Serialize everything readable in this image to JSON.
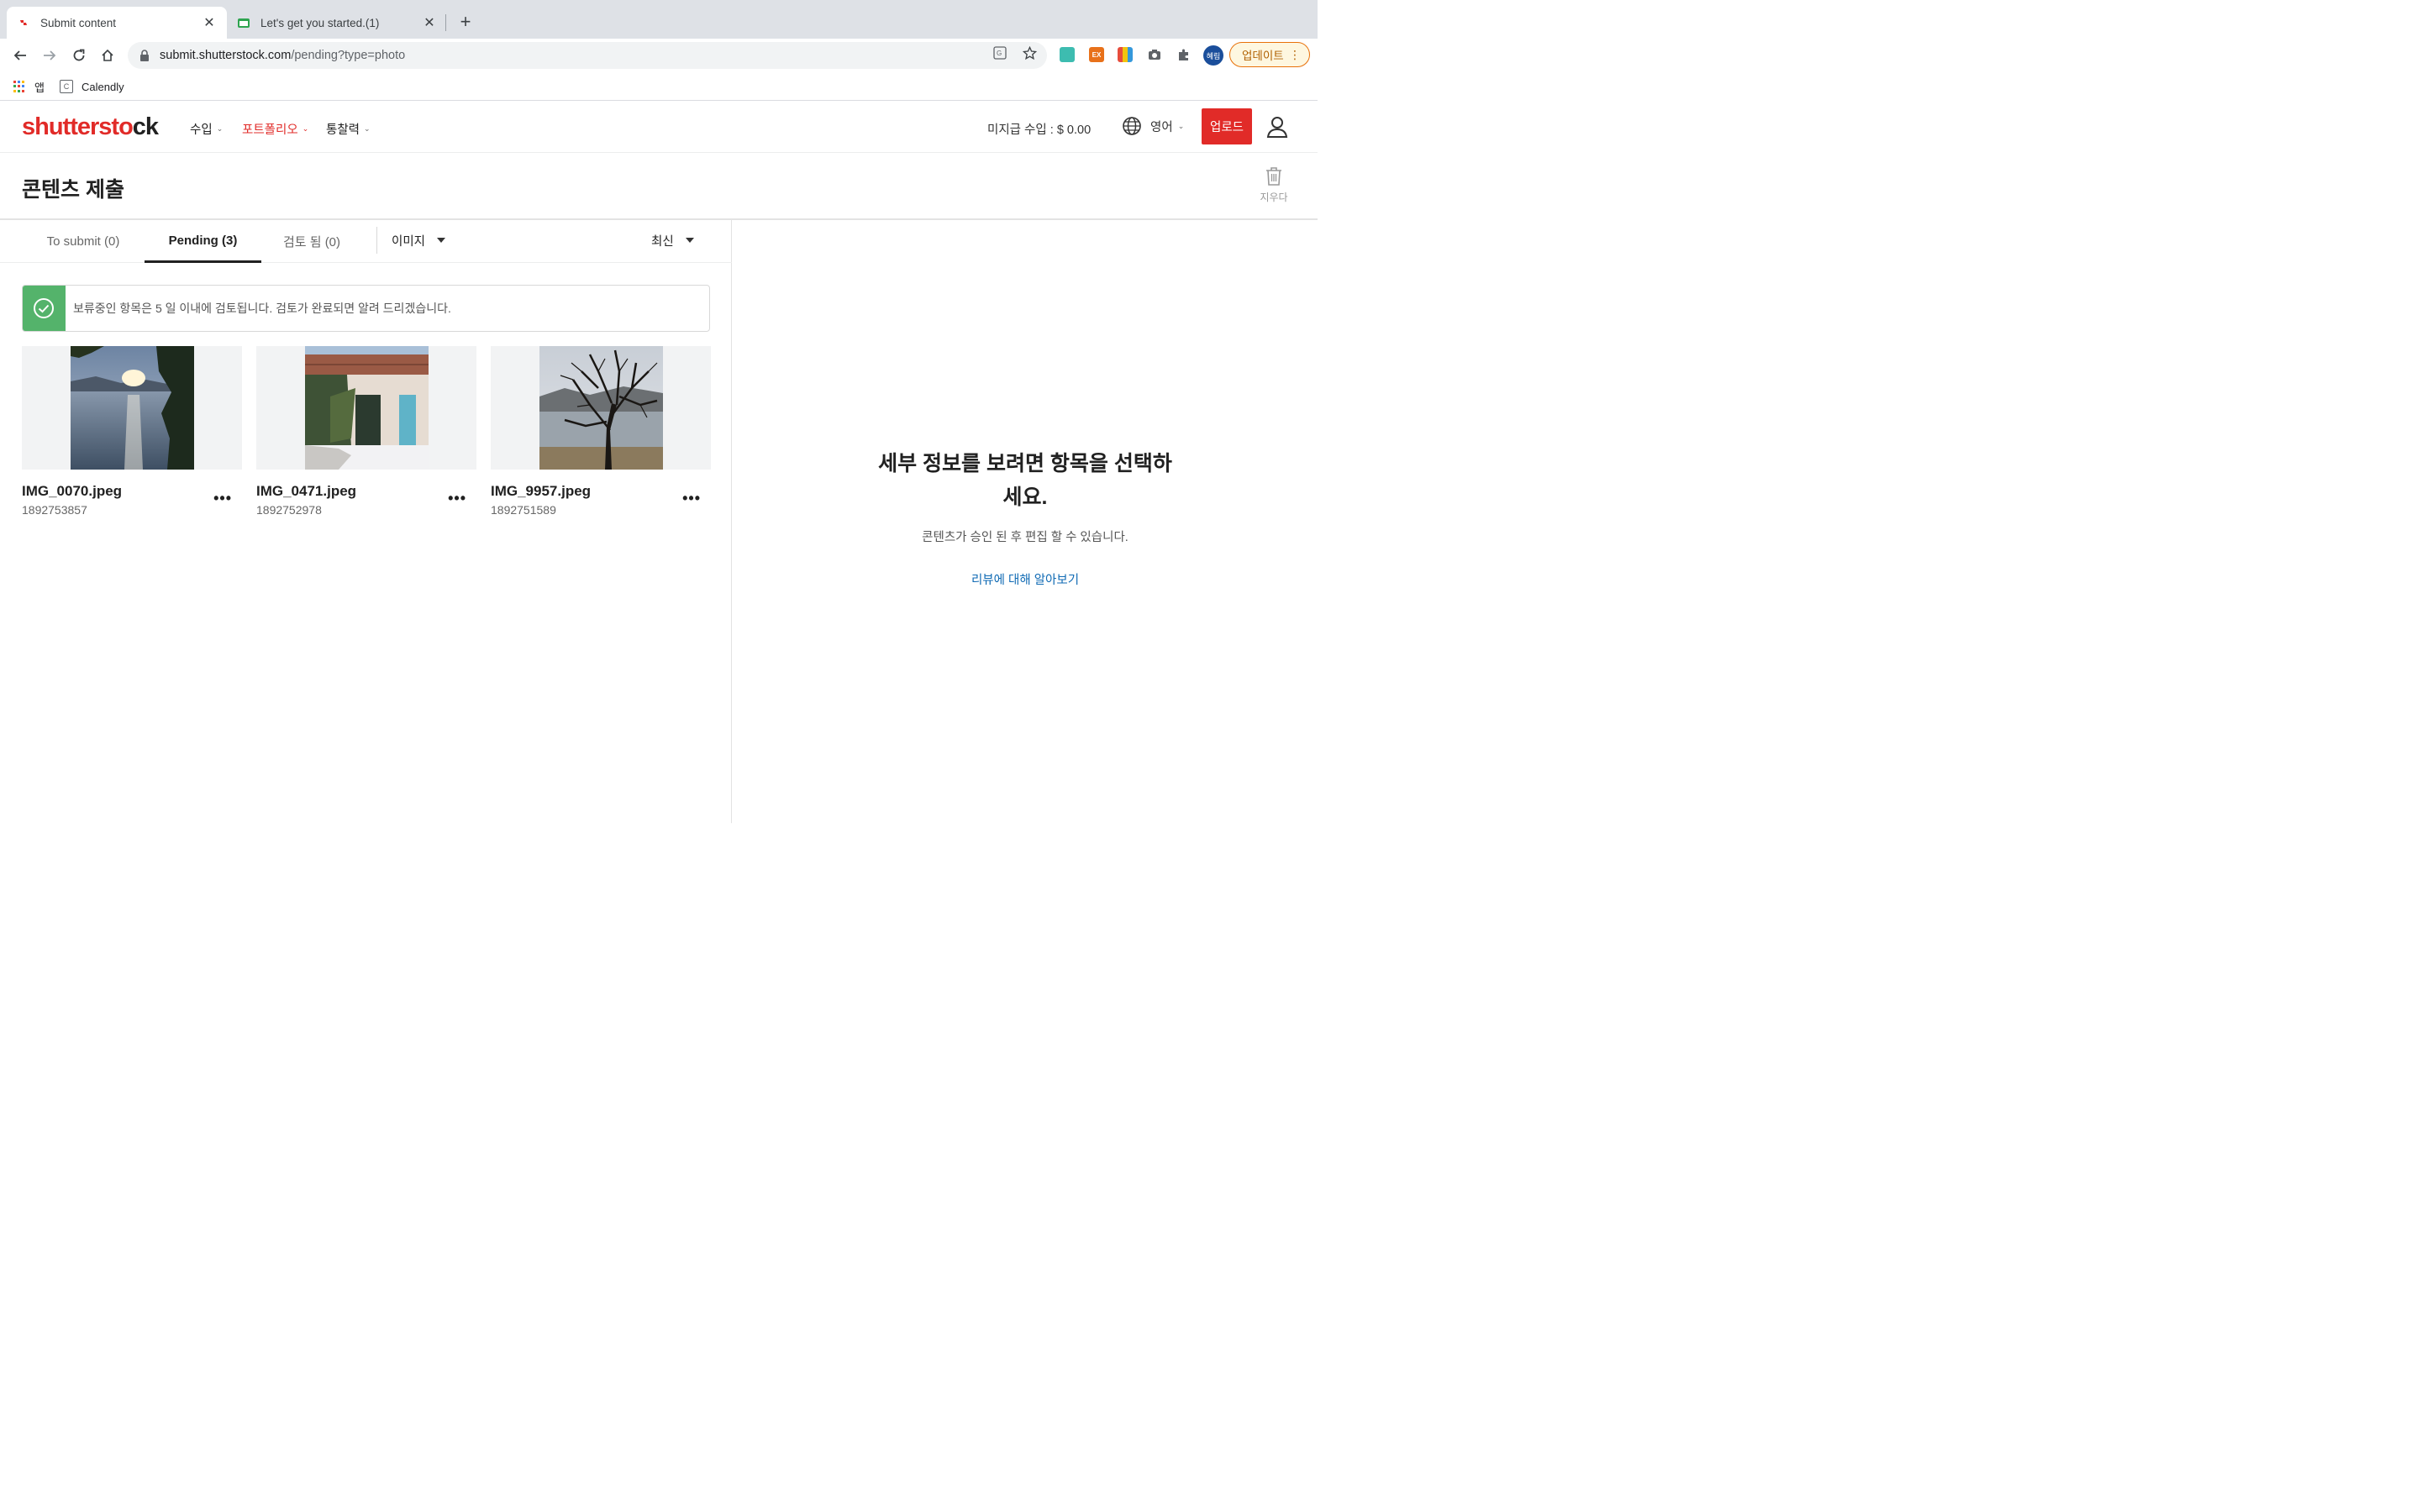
{
  "browser": {
    "tabs": [
      {
        "title": "Submit content",
        "active": true
      },
      {
        "title": "Let's get you started.(1)",
        "active": false
      }
    ],
    "url_host": "submit.shutterstock.com",
    "url_path": "/pending?type=photo",
    "profile_initials": "혜림",
    "update_label": "업데이트",
    "bookmarks": [
      {
        "label": "앱",
        "icon": "apps-grid-icon"
      },
      {
        "label": "Calendly",
        "icon": "calendly-icon"
      }
    ],
    "extensions": [
      {
        "name": "grammar-ext-icon",
        "color": "#3dbcb0",
        "label": ""
      },
      {
        "name": "ex-ext-icon",
        "color": "#e8711a",
        "label": "EX"
      },
      {
        "name": "color-ext-icon",
        "color": "#8e44ad",
        "label": ""
      },
      {
        "name": "camera-ext-icon",
        "color": "#5f6368",
        "label": ""
      }
    ]
  },
  "header": {
    "logo_red": "shutterst",
    "logo_mid": "o",
    "logo_dark": "ck",
    "nav": [
      {
        "label": "수입",
        "active": false
      },
      {
        "label": "포트폴리오",
        "active": true
      },
      {
        "label": "통찰력",
        "active": false
      }
    ],
    "earnings": "미지급 수입 : $ 0.00",
    "language": "영어",
    "upload_label": "업로드"
  },
  "page": {
    "title": "콘텐츠 제출",
    "delete_label": "지우다"
  },
  "content_tabs": [
    {
      "label": "To submit (0)",
      "active": false
    },
    {
      "label": "Pending (3)",
      "active": true
    },
    {
      "label": "검토 됨 (0)",
      "active": false
    }
  ],
  "filters": {
    "type": "이미지",
    "sort": "최신"
  },
  "notice": "보류중인 항목은 5 일 이내에 검토됩니다. 검토가 완료되면 알려 드리겠습니다.",
  "items": [
    {
      "name": "IMG_0070.jpeg",
      "id": "1892753857"
    },
    {
      "name": "IMG_0471.jpeg",
      "id": "1892752978"
    },
    {
      "name": "IMG_9957.jpeg",
      "id": "1892751589"
    }
  ],
  "detail_panel": {
    "empty_title": "세부 정보를 보려면 항목을 선택하세요.",
    "empty_subtitle": "콘텐츠가 승인 된 후 편집 할 수 있습니다.",
    "learn_link": "리뷰에 대해 알아보기"
  },
  "colors": {
    "brand_red": "#e12b28",
    "success_green": "#54b36b",
    "link_blue": "#0f6ab4"
  }
}
